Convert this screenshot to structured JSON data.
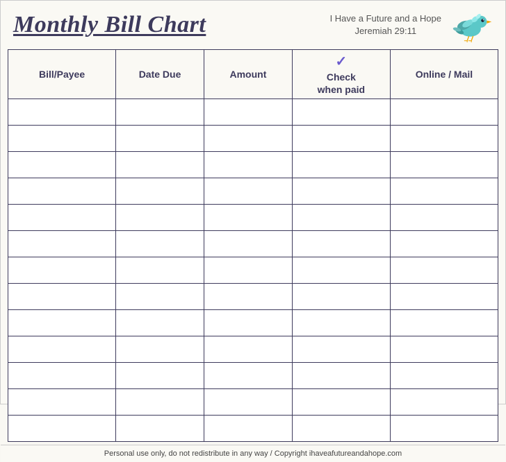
{
  "header": {
    "title": "Monthly Bill Chart",
    "subtitle_line1": "I Have a Future and a Hope",
    "subtitle_line2": "Jeremiah 29:11"
  },
  "table": {
    "columns": [
      {
        "id": "bill",
        "label": "Bill/Payee"
      },
      {
        "id": "date",
        "label": "Date Due"
      },
      {
        "id": "amount",
        "label": "Amount"
      },
      {
        "id": "check",
        "label": "when paid",
        "check_symbol": "✓",
        "prefix": "Check"
      },
      {
        "id": "online",
        "label": "Online / Mail"
      }
    ],
    "row_count": 13
  },
  "footer": {
    "text": "Personal use only, do not redistribute in any way / Copyright ihaveafutureandahope.com"
  }
}
